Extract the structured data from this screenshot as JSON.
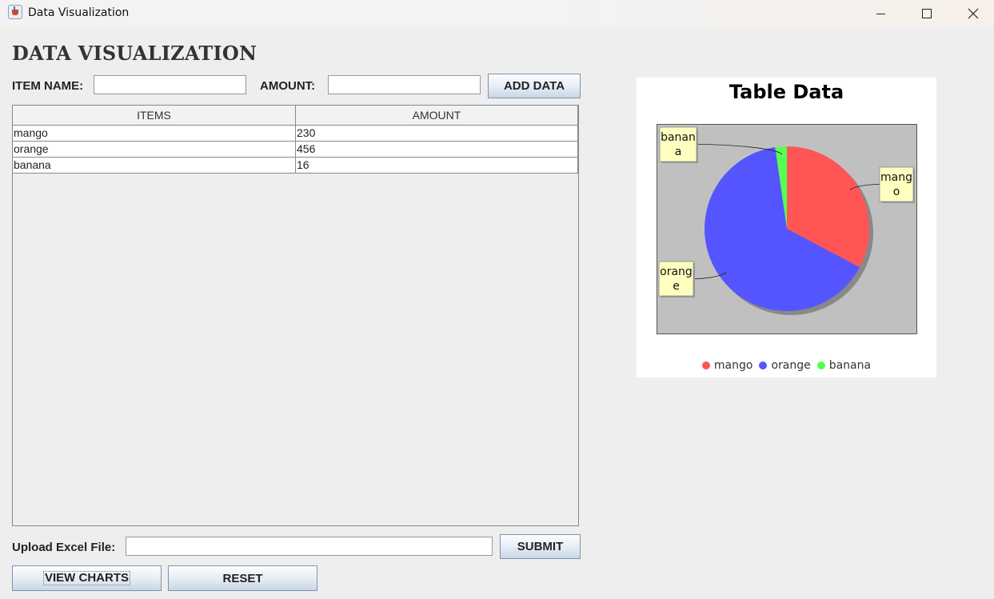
{
  "window": {
    "title": "Data Visualization"
  },
  "form": {
    "heading": "DATA VISUALIZATION",
    "item_name_label": "ITEM NAME:",
    "item_name_value": "",
    "amount_label": "AMOUNT:",
    "amount_value": "",
    "add_button": "ADD DATA"
  },
  "table": {
    "columns": [
      "ITEMS",
      "AMOUNT"
    ],
    "rows": [
      [
        "mango",
        "230"
      ],
      [
        "orange",
        "456"
      ],
      [
        "banana",
        "16"
      ]
    ]
  },
  "upload": {
    "label": "Upload Excel File:",
    "value": "",
    "submit_button": "SUBMIT"
  },
  "actions": {
    "view_charts": "VIEW CHARTS",
    "reset": "RESET"
  },
  "chart_data": {
    "type": "pie",
    "title": "Table Data",
    "categories": [
      "mango",
      "orange",
      "banana"
    ],
    "values": [
      230,
      456,
      16
    ],
    "slice_labels": [
      [
        "mang",
        "o"
      ],
      [
        "orang",
        "e"
      ],
      [
        "banan",
        "a"
      ]
    ],
    "colors": [
      "#ff5555",
      "#5555ff",
      "#55ff55"
    ],
    "legend_position": "bottom"
  }
}
